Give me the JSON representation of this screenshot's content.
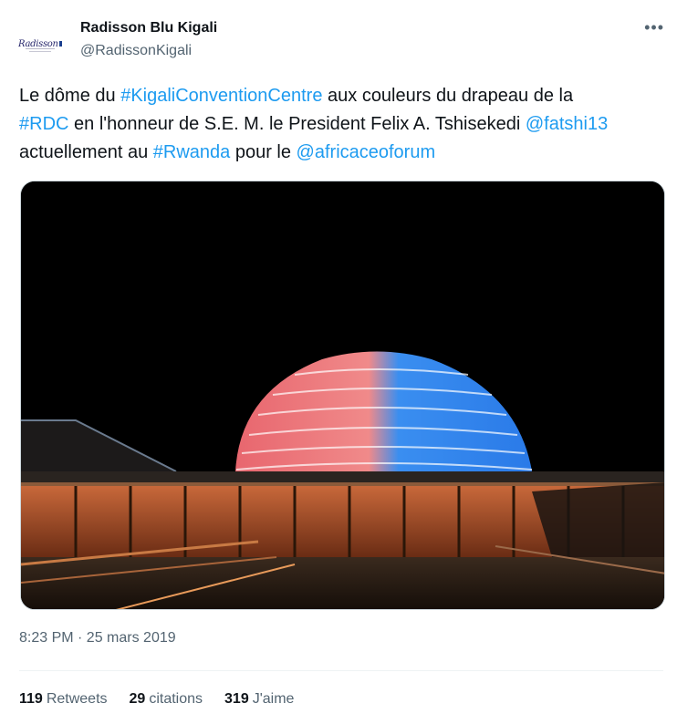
{
  "author": {
    "display_name": "Radisson Blu Kigali",
    "handle": "@RadissonKigali",
    "avatar_icon": "radisson-logo-icon"
  },
  "more_icon": "more-icon",
  "tweet": {
    "segments": [
      {
        "text": "Le dôme du ",
        "link": false
      },
      {
        "text": "#KigaliConventionCentre",
        "link": true
      },
      {
        "text": " aux couleurs du drapeau de la ",
        "link": false
      },
      {
        "text": "#RDC",
        "link": true
      },
      {
        "text": " en l'honneur de S.E. M. le President Felix A. Tshisekedi ",
        "link": false
      },
      {
        "text": "@fatshi13",
        "link": true
      },
      {
        "text": " actuellement au ",
        "link": false
      },
      {
        "text": "#Rwanda",
        "link": true
      },
      {
        "text": " pour le ",
        "link": false
      },
      {
        "text": "@africaceoforum",
        "link": true
      }
    ],
    "timestamp": "8:23 PM · 25 mars 2019",
    "media_icon": "convention-centre-dome-photo"
  },
  "stats": {
    "retweets_count": "119",
    "retweets_label": "Retweets",
    "quotes_count": "29",
    "quotes_label": "citations",
    "likes_count": "319",
    "likes_label": "J'aime"
  },
  "colors": {
    "link": "#1d9bf0",
    "secondary_text": "#536471",
    "primary_text": "#0f1419"
  }
}
